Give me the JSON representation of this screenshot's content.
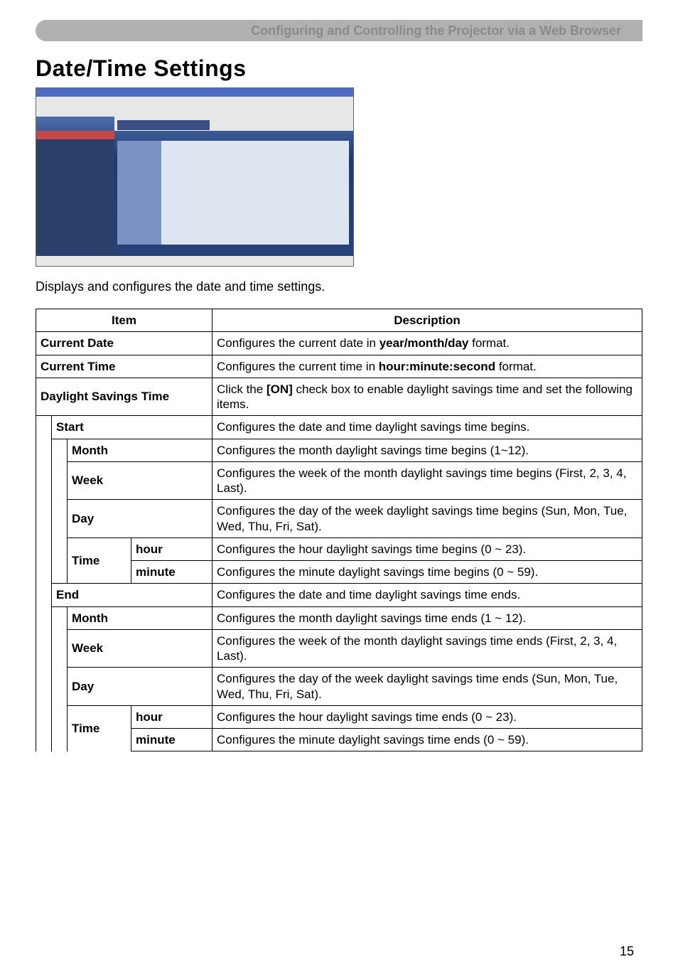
{
  "header": "Configuring and Controlling the Projector via a Web Browser",
  "sectionTitle": "Date/Time Settings",
  "caption": "Displays and configures the date and time settings.",
  "tableHeader": {
    "item": "Item",
    "description": "Description"
  },
  "rows": {
    "currentDate": {
      "item": "Current Date",
      "desc_pre": "Configures the current date in ",
      "desc_bold": "year/month/day",
      "desc_post": " format."
    },
    "currentTime": {
      "item": "Current Time",
      "desc_pre": "Configures the current time in ",
      "desc_bold": "hour:minute:second",
      "desc_post": " format."
    },
    "dst": {
      "item": "Daylight Savings Time",
      "desc_pre": "Click the ",
      "desc_bold": "[ON]",
      "desc_post": " check box to enable daylight savings time and set the following items."
    },
    "start": {
      "item": "Start",
      "desc": "Configures the date and time daylight savings time begins."
    },
    "startMonth": {
      "item": "Month",
      "desc": "Configures the month daylight savings time begins (1~12)."
    },
    "startWeek": {
      "item": "Week",
      "desc": "Configures the week of the month daylight savings time begins (First, 2, 3, 4, Last)."
    },
    "startDay": {
      "item": "Day",
      "desc": "Configures the day of the week daylight savings time begins (Sun, Mon, Tue, Wed, Thu, Fri, Sat)."
    },
    "startTime": {
      "item": "Time"
    },
    "startHour": {
      "item": "hour",
      "desc": "Configures the hour daylight savings time begins (0 ~ 23)."
    },
    "startMinute": {
      "item": "minute",
      "desc": "Configures the minute daylight savings time begins (0 ~ 59)."
    },
    "end": {
      "item": "End",
      "desc": "Configures the date and time daylight savings time ends."
    },
    "endMonth": {
      "item": "Month",
      "desc": "Configures the month daylight savings time ends (1 ~ 12)."
    },
    "endWeek": {
      "item": "Week",
      "desc": "Configures the week of the month daylight savings time ends (First, 2, 3, 4, Last)."
    },
    "endDay": {
      "item": "Day",
      "desc": "Configures the day of the week daylight savings time ends (Sun, Mon, Tue, Wed, Thu, Fri, Sat)."
    },
    "endTime": {
      "item": "Time"
    },
    "endHour": {
      "item": "hour",
      "desc": "Configures the hour daylight savings time ends (0 ~ 23)."
    },
    "endMinute": {
      "item": "minute",
      "desc": "Configures the minute daylight savings time ends  (0 ~ 59)."
    }
  },
  "pageNumber": "15"
}
